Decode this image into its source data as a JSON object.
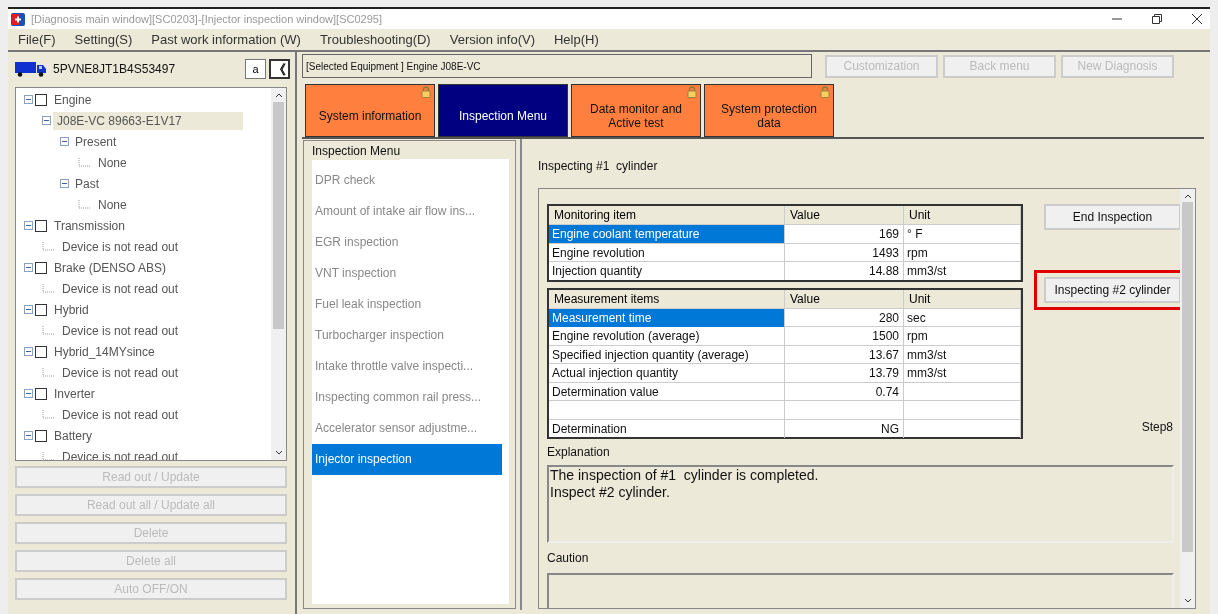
{
  "window": {
    "title": "[Diagnosis main window][SC0203]-[Injector inspection window][SC0295]"
  },
  "menu": [
    "File(F)",
    "Setting(S)",
    "Past work information (W)",
    "Troubleshooting(D)",
    "Version info(V)",
    "Help(H)"
  ],
  "vehicle": {
    "id": "5PVNE8JT1B4S53497",
    "font_button": "a",
    "collapse_button": "《"
  },
  "tree": [
    {
      "label": "Engine",
      "checked": false,
      "selected": false,
      "children": [
        {
          "label": "J08E-VC 89663-E1V17",
          "selected": true,
          "children": [
            {
              "label": "Present",
              "selected": false,
              "children": [
                {
                  "label": "None",
                  "selected": false
                }
              ]
            },
            {
              "label": "Past",
              "selected": false,
              "children": [
                {
                  "label": "None",
                  "selected": false
                }
              ]
            }
          ]
        }
      ]
    },
    {
      "label": "Transmission",
      "checked": false,
      "selected": false,
      "children": [
        {
          "label": "Device is not read out",
          "selected": false
        }
      ]
    },
    {
      "label": "Brake (DENSO ABS)",
      "checked": false,
      "selected": false,
      "children": [
        {
          "label": "Device is not read out",
          "selected": false
        }
      ]
    },
    {
      "label": "Hybrid",
      "checked": false,
      "selected": false,
      "children": [
        {
          "label": "Device is not read out",
          "selected": false
        }
      ]
    },
    {
      "label": "Hybrid_14MYsince",
      "checked": false,
      "selected": false,
      "children": [
        {
          "label": "Device is not read out",
          "selected": false
        }
      ]
    },
    {
      "label": "Inverter",
      "checked": false,
      "selected": false,
      "children": [
        {
          "label": "Device is not read out",
          "selected": false
        }
      ]
    },
    {
      "label": "Battery",
      "checked": false,
      "selected": false,
      "children": [
        {
          "label": "Device is not read out",
          "selected": false
        }
      ]
    }
  ],
  "left_buttons": [
    {
      "label": "Read out / Update",
      "disabled": true
    },
    {
      "label": "Read out all / Update all",
      "disabled": true
    },
    {
      "label": "Delete",
      "disabled": true
    },
    {
      "label": "Delete all",
      "disabled": true
    },
    {
      "label": "Auto OFF/ON",
      "disabled": true
    }
  ],
  "selected_equipment": "[Selected Equipment ] Engine J08E-VC",
  "top_buttons": [
    {
      "label": "Customization",
      "disabled": true
    },
    {
      "label": "Back menu",
      "disabled": true
    },
    {
      "label": "New Diagnosis",
      "disabled": true
    }
  ],
  "tabs": [
    {
      "label": "System information",
      "selected": false,
      "locked": true
    },
    {
      "label": "Inspection Menu",
      "selected": true,
      "locked": false
    },
    {
      "label": "Data monitor and Active test",
      "selected": false,
      "locked": true
    },
    {
      "label": "System protection data",
      "selected": false,
      "locked": true
    }
  ],
  "inspection_menu": {
    "title": "Inspection Menu",
    "items": [
      {
        "label": "DPR check",
        "selected": false
      },
      {
        "label": "Amount of intake air flow ins...",
        "selected": false
      },
      {
        "label": "EGR inspection",
        "selected": false
      },
      {
        "label": "VNT inspection",
        "selected": false
      },
      {
        "label": "Fuel leak inspection",
        "selected": false
      },
      {
        "label": "Turbocharger inspection",
        "selected": false
      },
      {
        "label": "Intake throttle valve inspecti...",
        "selected": false
      },
      {
        "label": "Inspecting common rail press...",
        "selected": false
      },
      {
        "label": "Accelerator sensor adjustme...",
        "selected": false
      },
      {
        "label": "Injector inspection",
        "selected": true
      }
    ]
  },
  "inspection": {
    "heading": "Inspecting #1  cylinder",
    "monitoring_table": {
      "columns": [
        "Monitoring item",
        "Value",
        "Unit"
      ],
      "rows": [
        {
          "kind": "data",
          "selected": true,
          "cells": [
            "Engine coolant temperature",
            "169",
            "°  F"
          ]
        },
        {
          "kind": "data",
          "selected": false,
          "cells": [
            "Engine revolution",
            "1493",
            "rpm"
          ]
        },
        {
          "kind": "data",
          "selected": false,
          "cells": [
            "Injection quantity",
            "14.88",
            "mm3/st"
          ]
        }
      ]
    },
    "measurement_table": {
      "columns": [
        "Measurement items",
        "Value",
        "Unit"
      ],
      "rows": [
        {
          "kind": "data",
          "selected": true,
          "cells": [
            "Measurement time",
            "280",
            "sec"
          ]
        },
        {
          "kind": "data",
          "selected": false,
          "cells": [
            "Engine revolution (average)",
            "1500",
            "rpm"
          ]
        },
        {
          "kind": "data",
          "selected": false,
          "cells": [
            "Specified injection quantity (average)",
            "13.67",
            "mm3/st"
          ]
        },
        {
          "kind": "data",
          "selected": false,
          "cells": [
            "Actual injection quantity",
            "13.79",
            "mm3/st"
          ]
        },
        {
          "kind": "data",
          "selected": false,
          "cells": [
            "Determination value",
            "0.74"
          ]
        },
        {
          "kind": "blank",
          "selected": false
        },
        {
          "kind": "data",
          "selected": false,
          "cells": [
            "Determination",
            "NG"
          ]
        }
      ]
    },
    "buttons": [
      {
        "label": "End Inspection",
        "highlighted": false
      },
      {
        "label": "Inspecting #2 cylinder",
        "highlighted": true
      }
    ],
    "step": "Step8",
    "explanation_label": "Explanation",
    "explanation": [
      "The inspection of #1  cylinder is completed.",
      "Inspect #2 cylinder."
    ],
    "caution_label": "Caution"
  }
}
